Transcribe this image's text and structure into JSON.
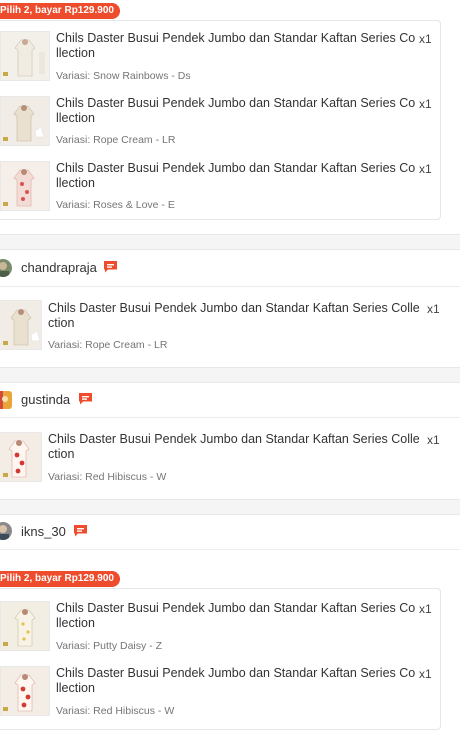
{
  "bundles": [
    {
      "badge": "Pilih 2, bayar Rp129.900",
      "items": [
        {
          "title": "Chils Daster Busui Pendek Jumbo dan Standar Kaftan Series Co llection",
          "qty": "x1",
          "variant": "Variasi: Snow Rainbows - Ds"
        },
        {
          "title": "Chils Daster Busui Pendek Jumbo dan Standar Kaftan Series Co llection",
          "qty": "x1",
          "variant": "Variasi: Rope Cream - LR"
        },
        {
          "title": "Chils Daster Busui Pendek Jumbo dan Standar Kaftan Series Co llection",
          "qty": "x1",
          "variant": "Variasi: Roses & Love - E"
        }
      ]
    },
    {
      "badge": "Pilih 2, bayar Rp129.900",
      "items": [
        {
          "title": "Chils Daster Busui Pendek Jumbo dan Standar Kaftan Series Co llection",
          "qty": "x1",
          "variant": "Variasi: Putty Daisy - Z"
        },
        {
          "title": "Chils Daster Busui Pendek Jumbo dan Standar Kaftan Series Co llection",
          "qty": "x1",
          "variant": "Variasi: Red Hibiscus - W"
        }
      ]
    }
  ],
  "shops": [
    {
      "name": "chandrapraja",
      "items": [
        {
          "title": "Chils Daster Busui Pendek Jumbo dan Standar Kaftan Series Colle ction",
          "qty": "x1",
          "variant": "Variasi: Rope Cream - LR"
        }
      ]
    },
    {
      "name": "gustinda",
      "items": [
        {
          "title": "Chils Daster Busui Pendek Jumbo dan Standar Kaftan Series Colle ction",
          "qty": "x1",
          "variant": "Variasi: Red Hibiscus - W"
        }
      ]
    },
    {
      "name": "ikns_30",
      "items": []
    }
  ],
  "colors": {
    "accent": "#ee4d2d",
    "separator": "#f5f5f5"
  },
  "icons": {
    "chat": "chat-bubble-icon"
  }
}
